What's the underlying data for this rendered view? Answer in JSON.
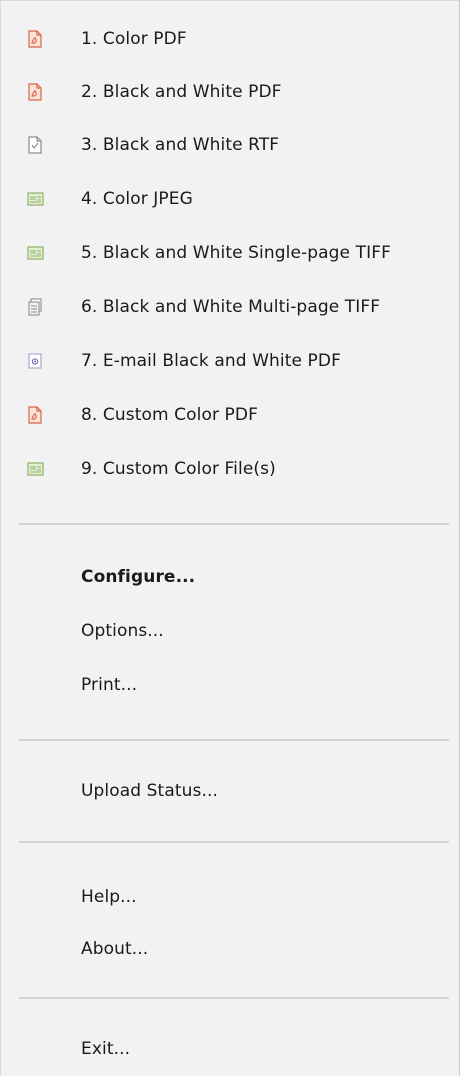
{
  "profiles": [
    {
      "label": "1. Color PDF",
      "icon": "pdf-color-icon",
      "color": "#d9664a"
    },
    {
      "label": "2. Black and White PDF",
      "icon": "pdf-color-icon",
      "color": "#d9664a"
    },
    {
      "label": "3. Black and White RTF",
      "icon": "rtf-document-icon",
      "color": "#8c8c8c"
    },
    {
      "label": "4. Color JPEG",
      "icon": "jpeg-image-icon",
      "color": "#8fb36b"
    },
    {
      "label": "5. Black and White Single-page TIFF",
      "icon": "tiff-image-icon",
      "color": "#8fb36b"
    },
    {
      "label": "6. Black and White Multi-page TIFF",
      "icon": "multipage-tiff-icon",
      "color": "#8c8c8c"
    },
    {
      "label": "7. E-mail Black and White PDF",
      "icon": "email-document-icon",
      "color": "#6b6bb3"
    },
    {
      "label": "8. Custom Color PDF",
      "icon": "pdf-color-icon",
      "color": "#d9664a"
    },
    {
      "label": "9. Custom Color File(s)",
      "icon": "file-image-icon",
      "color": "#8fb36b"
    }
  ],
  "actions": {
    "configure": "Configure...",
    "options": "Options...",
    "print": "Print...",
    "upload_status": "Upload Status...",
    "help": "Help...",
    "about": "About...",
    "exit": "Exit..."
  }
}
